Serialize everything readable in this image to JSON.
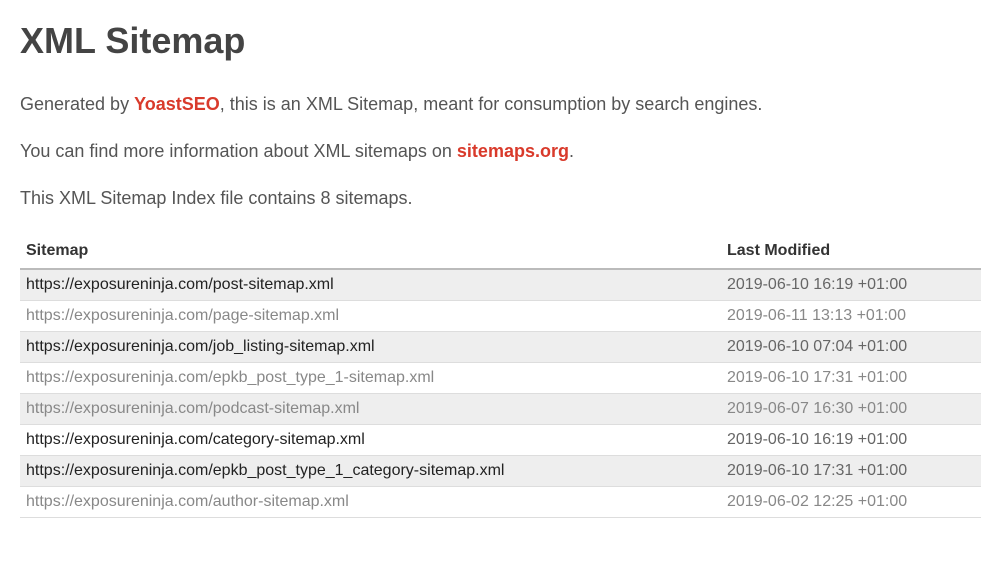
{
  "title": "XML Sitemap",
  "intro": {
    "p1_prefix": "Generated by ",
    "p1_link": "YoastSEO",
    "p1_suffix": ", this is an XML Sitemap, meant for consumption by search engines.",
    "p2_prefix": "You can find more information about XML sitemaps on ",
    "p2_link": "sitemaps.org",
    "p2_suffix": ".",
    "p3": "This XML Sitemap Index file contains 8 sitemaps."
  },
  "table": {
    "headers": {
      "sitemap": "Sitemap",
      "last_modified": "Last Modified"
    },
    "rows": [
      {
        "url": "https://exposureninja.com/post-sitemap.xml",
        "last_modified": "2019-06-10 16:19 +01:00",
        "muted": false
      },
      {
        "url": "https://exposureninja.com/page-sitemap.xml",
        "last_modified": "2019-06-11 13:13 +01:00",
        "muted": true
      },
      {
        "url": "https://exposureninja.com/job_listing-sitemap.xml",
        "last_modified": "2019-06-10 07:04 +01:00",
        "muted": false
      },
      {
        "url": "https://exposureninja.com/epkb_post_type_1-sitemap.xml",
        "last_modified": "2019-06-10 17:31 +01:00",
        "muted": true
      },
      {
        "url": "https://exposureninja.com/podcast-sitemap.xml",
        "last_modified": "2019-06-07 16:30 +01:00",
        "muted": true
      },
      {
        "url": "https://exposureninja.com/category-sitemap.xml",
        "last_modified": "2019-06-10 16:19 +01:00",
        "muted": false
      },
      {
        "url": "https://exposureninja.com/epkb_post_type_1_category-sitemap.xml",
        "last_modified": "2019-06-10 17:31 +01:00",
        "muted": false
      },
      {
        "url": "https://exposureninja.com/author-sitemap.xml",
        "last_modified": "2019-06-02 12:25 +01:00",
        "muted": true
      }
    ]
  }
}
